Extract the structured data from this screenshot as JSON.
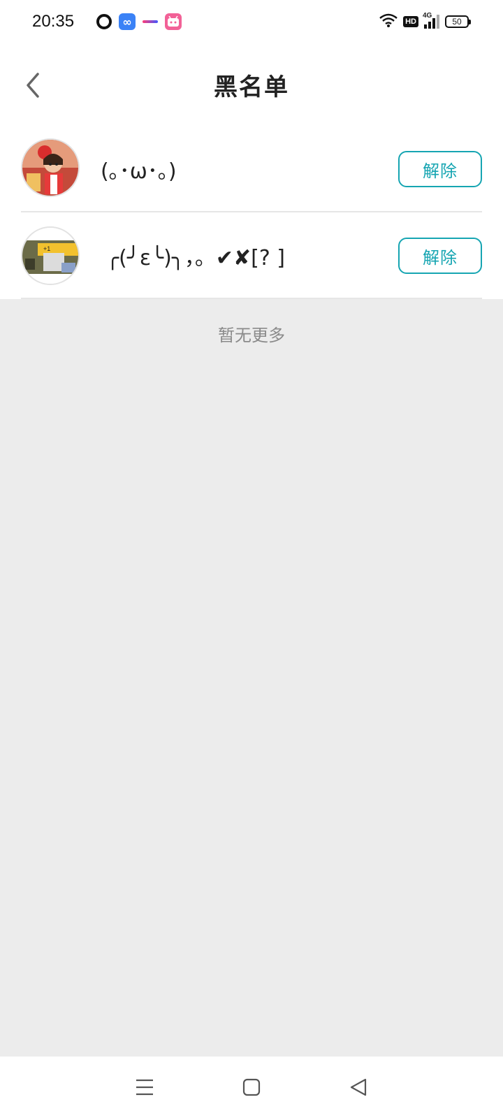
{
  "status_bar": {
    "time": "20:35",
    "network": "4G",
    "hd": "HD",
    "battery": "50",
    "app_icons": [
      "q-app-icon",
      "infinity-app-icon",
      "dash-app-icon",
      "bilibili-app-icon"
    ]
  },
  "header": {
    "title": "黑名单",
    "back_icon": "chevron-left-icon"
  },
  "blocked_users": [
    {
      "name": "(｡･ω･｡)",
      "action_label": "解除",
      "avatar": "anime-girl-avatar"
    },
    {
      "name": "╭(╯ε╰)╮，。✔✘[? ]",
      "action_label": "解除",
      "avatar": "game-screenshot-avatar"
    }
  ],
  "footer_text": "暂无更多",
  "colors": {
    "accent": "#16a5b2",
    "background": "#ececec",
    "divider": "#e6e6e6"
  },
  "system_nav": [
    "menu-icon",
    "home-icon",
    "back-icon"
  ]
}
